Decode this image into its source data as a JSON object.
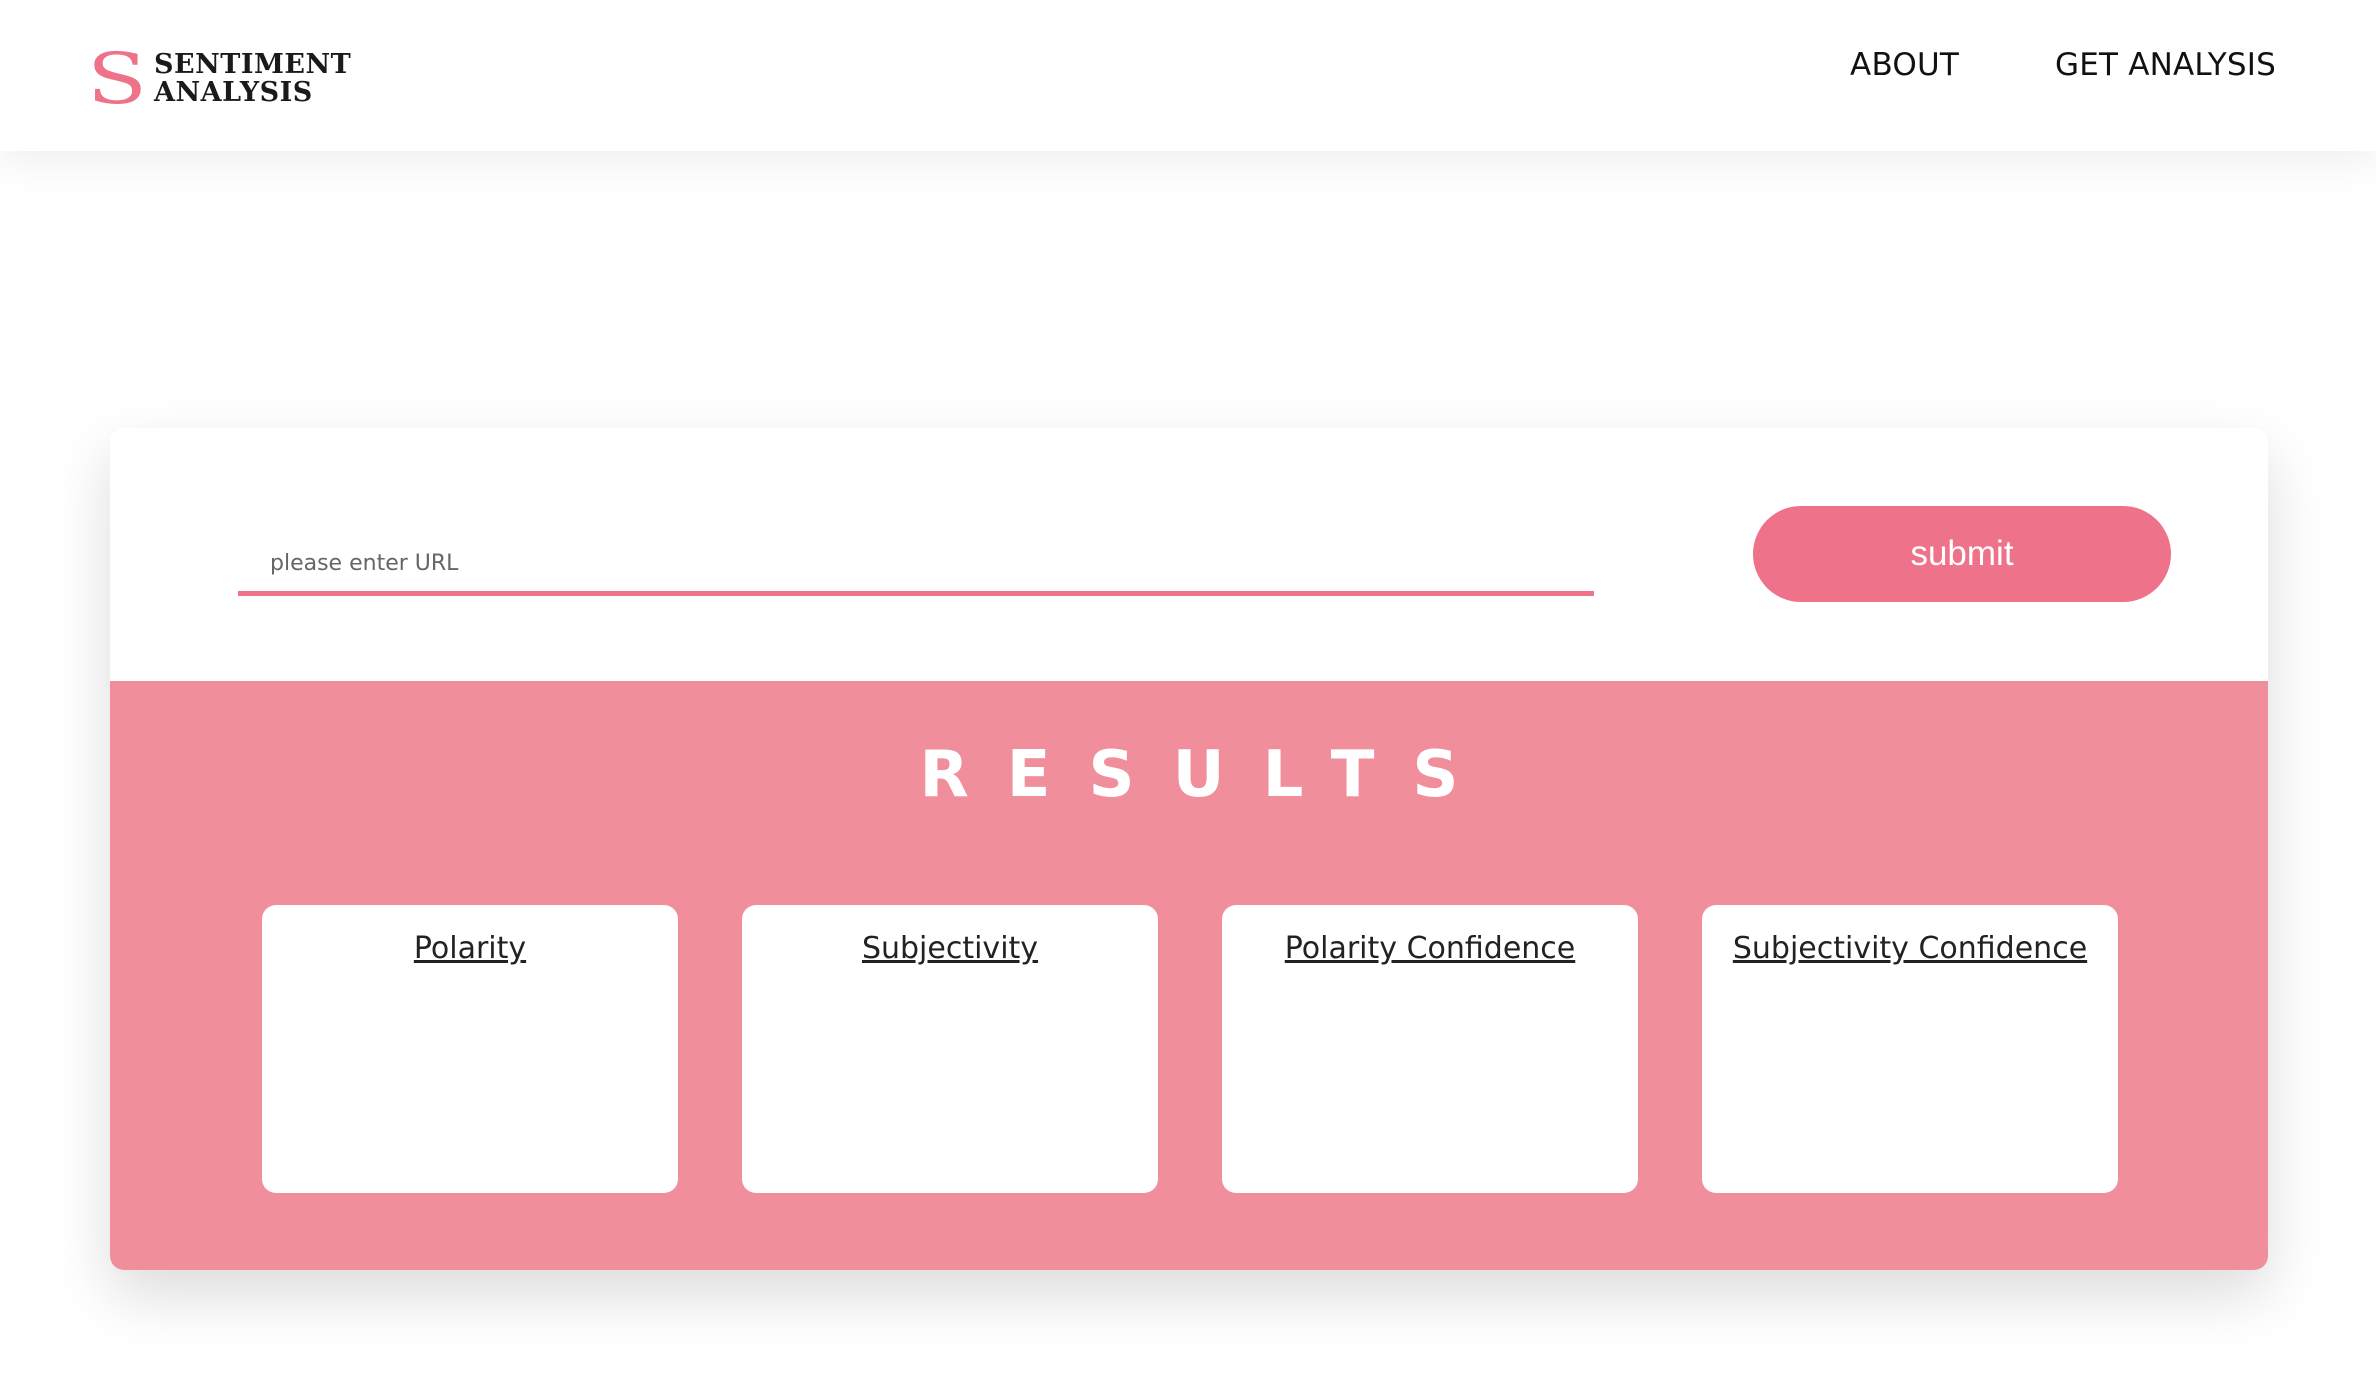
{
  "header": {
    "logo_letter": "S",
    "logo_line1": "SENTIMENT",
    "logo_line2": "ANALYSIS",
    "nav": {
      "about": "ABOUT",
      "get_analysis": "GET ANALYSIS"
    }
  },
  "form": {
    "url_placeholder": "please enter URL",
    "url_value": "",
    "submit_label": "submit"
  },
  "results": {
    "title": "RESULTS",
    "metrics": [
      {
        "label": "Polarity",
        "value": ""
      },
      {
        "label": "Subjectivity",
        "value": ""
      },
      {
        "label": "Polarity Confidence",
        "value": ""
      },
      {
        "label": "Subjectivity Confidence",
        "value": ""
      }
    ]
  },
  "colors": {
    "accent": "#ee7289",
    "results_background": "#f18e9c"
  }
}
